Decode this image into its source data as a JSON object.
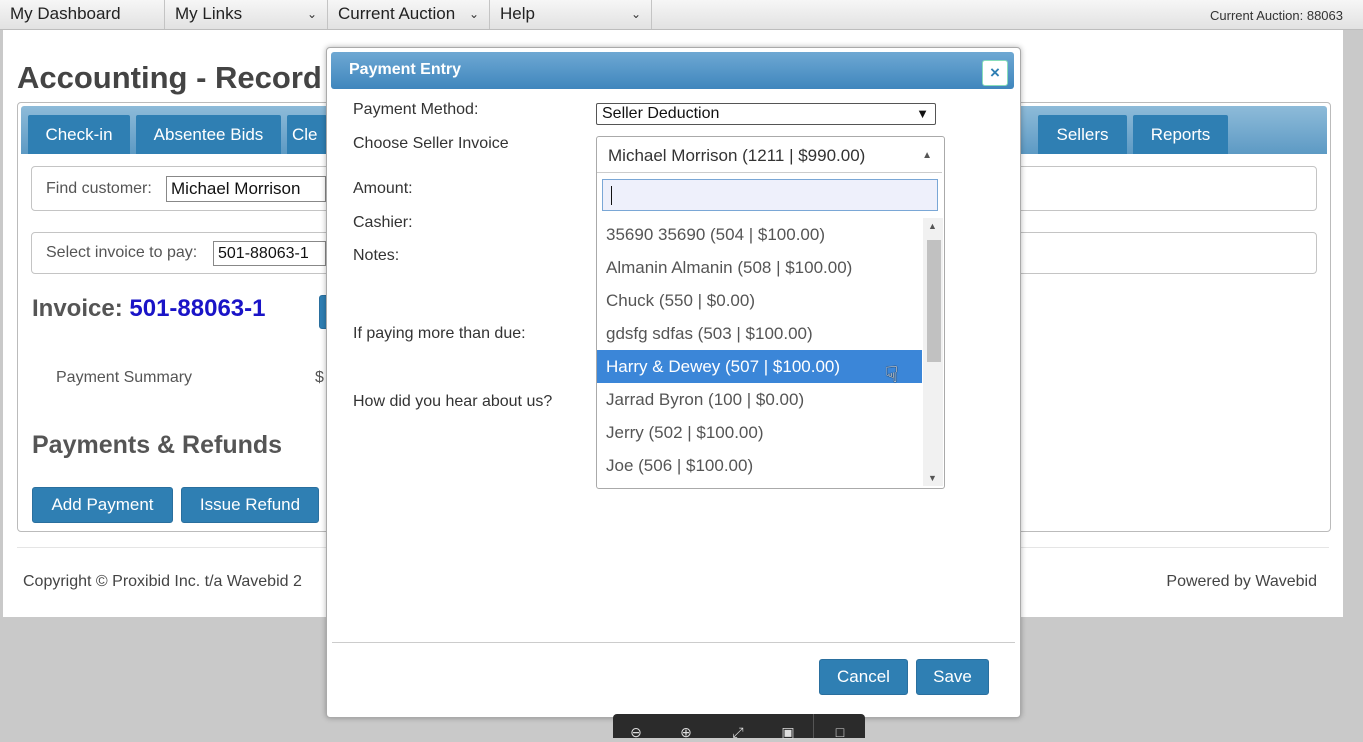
{
  "topnav": {
    "items": [
      {
        "label": "My Dashboard"
      },
      {
        "label": "My Links"
      },
      {
        "label": "Current Auction"
      },
      {
        "label": "Help"
      }
    ],
    "current_auction_text": "Current Auction: 88063"
  },
  "page": {
    "title": "Accounting - Record I",
    "tabs": [
      "Check-in",
      "Absentee Bids",
      "Cle",
      "Sellers",
      "Reports"
    ],
    "find_customer": {
      "label": "Find customer:",
      "value": "Michael Morrison"
    },
    "select_invoice": {
      "label": "Select invoice to pay:",
      "value": "501-88063-1"
    },
    "invoice_label": "Invoice:",
    "invoice_number": "501-88063-1",
    "payment_summary": "Payment Summary",
    "summary_value_fragment": "$",
    "payments_heading": "Payments & Refunds",
    "add_payment": "Add Payment",
    "issue_refund": "Issue Refund",
    "copyright": "Copyright © Proxibid Inc. t/a Wavebid 2",
    "powered_by": "Powered by Wavebid"
  },
  "modal": {
    "title": "Payment Entry",
    "close_label": "×",
    "labels": {
      "payment_method": "Payment Method:",
      "choose_invoice": "Choose Seller Invoice",
      "amount": "Amount:",
      "cashier": "Cashier:",
      "notes": "Notes:",
      "paying_more": "If paying more than due:",
      "hear_about": "How did you hear about us?"
    },
    "payment_method_value": "Seller Deduction",
    "invoice_selected": "Michael Morrison (1211 | $990.00)",
    "search_value": "",
    "options": [
      "35690 35690 (504 | $100.00)",
      "Almanin Almanin (508 | $100.00)",
      "Chuck (550 | $0.00)",
      "gdsfg sdfas (503 | $100.00)",
      "Harry & Dewey (507 | $100.00)",
      "Jarrad Byron (100 | $0.00)",
      "Jerry (502 | $100.00)",
      "Joe (506 | $100.00)"
    ],
    "highlighted_index": 4,
    "cancel": "Cancel",
    "save": "Save"
  },
  "colors": {
    "primary_button": "#2f7fb3",
    "highlight": "#3b86d8",
    "invoice_link": "#1a14c7"
  }
}
